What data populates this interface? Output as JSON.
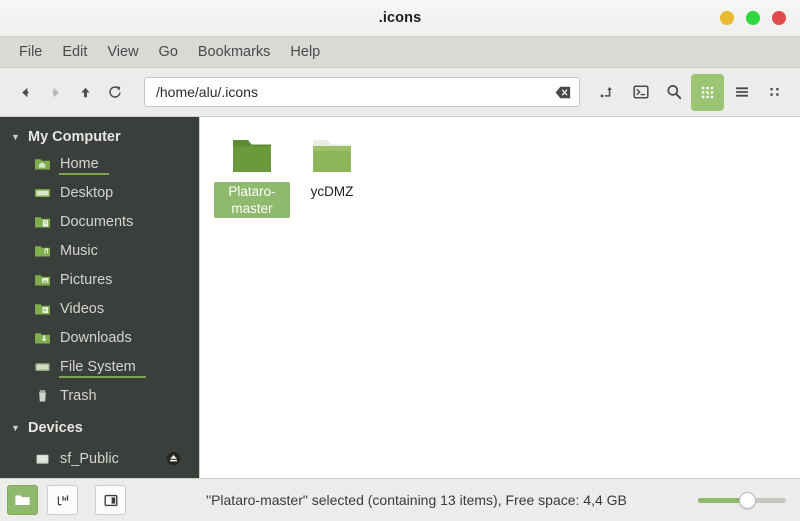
{
  "window": {
    "title": ".icons",
    "controls": [
      {
        "name": "minimize",
        "color": "#e8b931"
      },
      {
        "name": "maximize",
        "color": "#2fd83e"
      },
      {
        "name": "close",
        "color": "#e04b4b"
      }
    ]
  },
  "menubar": {
    "items": [
      {
        "label": "File"
      },
      {
        "label": "Edit"
      },
      {
        "label": "View"
      },
      {
        "label": "Go"
      },
      {
        "label": "Bookmarks"
      },
      {
        "label": "Help"
      }
    ]
  },
  "toolbar": {
    "nav": [
      {
        "name": "back-icon",
        "enabled": true
      },
      {
        "name": "forward-icon",
        "enabled": false
      },
      {
        "name": "up-icon",
        "enabled": true
      },
      {
        "name": "reload-icon",
        "enabled": true
      }
    ],
    "path": {
      "value": "/home/alu/.icons",
      "placeholder": "Location",
      "clear_icon": "clear-icon"
    },
    "buttons": [
      {
        "name": "open-new-pane-icon",
        "active": false
      },
      {
        "name": "open-terminal-icon",
        "active": false
      },
      {
        "name": "search-icon",
        "active": false
      },
      {
        "name": "icon-view-icon",
        "active": true
      },
      {
        "name": "list-view-icon",
        "active": false
      },
      {
        "name": "compact-view-icon",
        "active": false
      }
    ]
  },
  "sidebar": {
    "groups": [
      {
        "label": "My Computer",
        "expanded": true,
        "items": [
          {
            "label": "Home",
            "icon": "home-folder-icon",
            "underlined": true
          },
          {
            "label": "Desktop",
            "icon": "desktop-icon",
            "underlined": false
          },
          {
            "label": "Documents",
            "icon": "documents-folder-icon",
            "underlined": false
          },
          {
            "label": "Music",
            "icon": "music-folder-icon",
            "underlined": false
          },
          {
            "label": "Pictures",
            "icon": "pictures-folder-icon",
            "underlined": false
          },
          {
            "label": "Videos",
            "icon": "videos-folder-icon",
            "underlined": false
          },
          {
            "label": "Downloads",
            "icon": "downloads-folder-icon",
            "underlined": false
          },
          {
            "label": "File System",
            "icon": "file-system-icon",
            "underlined": true
          },
          {
            "label": "Trash",
            "icon": "trash-icon",
            "underlined": false
          }
        ]
      },
      {
        "label": "Devices",
        "expanded": true,
        "items": [
          {
            "label": "sf_Public",
            "icon": "drive-icon",
            "underlined": false,
            "eject": true
          }
        ]
      }
    ]
  },
  "fileview": {
    "items": [
      {
        "label": "Plataro-master",
        "icon": "folder-icon",
        "selected": true
      },
      {
        "label": "ycDMZ",
        "icon": "folder-icon",
        "selected": false
      }
    ]
  },
  "statusbar": {
    "buttons": [
      {
        "name": "folder-view-button",
        "active": true
      },
      {
        "name": "properties-button",
        "active": false
      },
      {
        "name": "toggle-sidebar-button",
        "active": false
      }
    ],
    "text": "\"Plataro-master\" selected (containing 13 items), Free space: 4,4 GB",
    "zoom": {
      "value": 55
    }
  },
  "colors": {
    "accent_green": "#8fb96c",
    "sidebar_bg": "#3b3f3c",
    "toolbar_bg": "#ececea"
  }
}
